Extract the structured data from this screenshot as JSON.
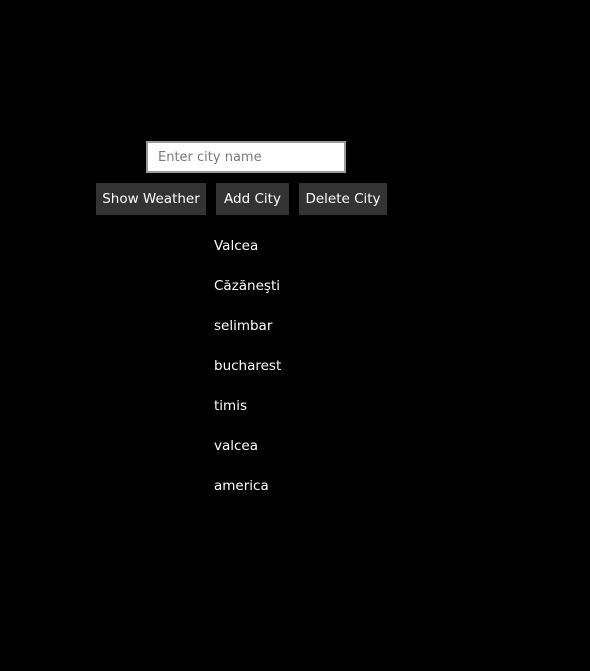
{
  "search": {
    "placeholder": "Enter city name",
    "value": ""
  },
  "toolbar": {
    "show_weather_label": "Show Weather",
    "add_city_label": "Add City",
    "delete_city_label": "Delete City"
  },
  "cities": [
    "Valcea",
    "Căzăneşti",
    "selimbar",
    "bucharest",
    "timis",
    "valcea",
    "america"
  ],
  "colors": {
    "background": "#000000",
    "button_bg": "#333333",
    "text": "#ffffff"
  }
}
